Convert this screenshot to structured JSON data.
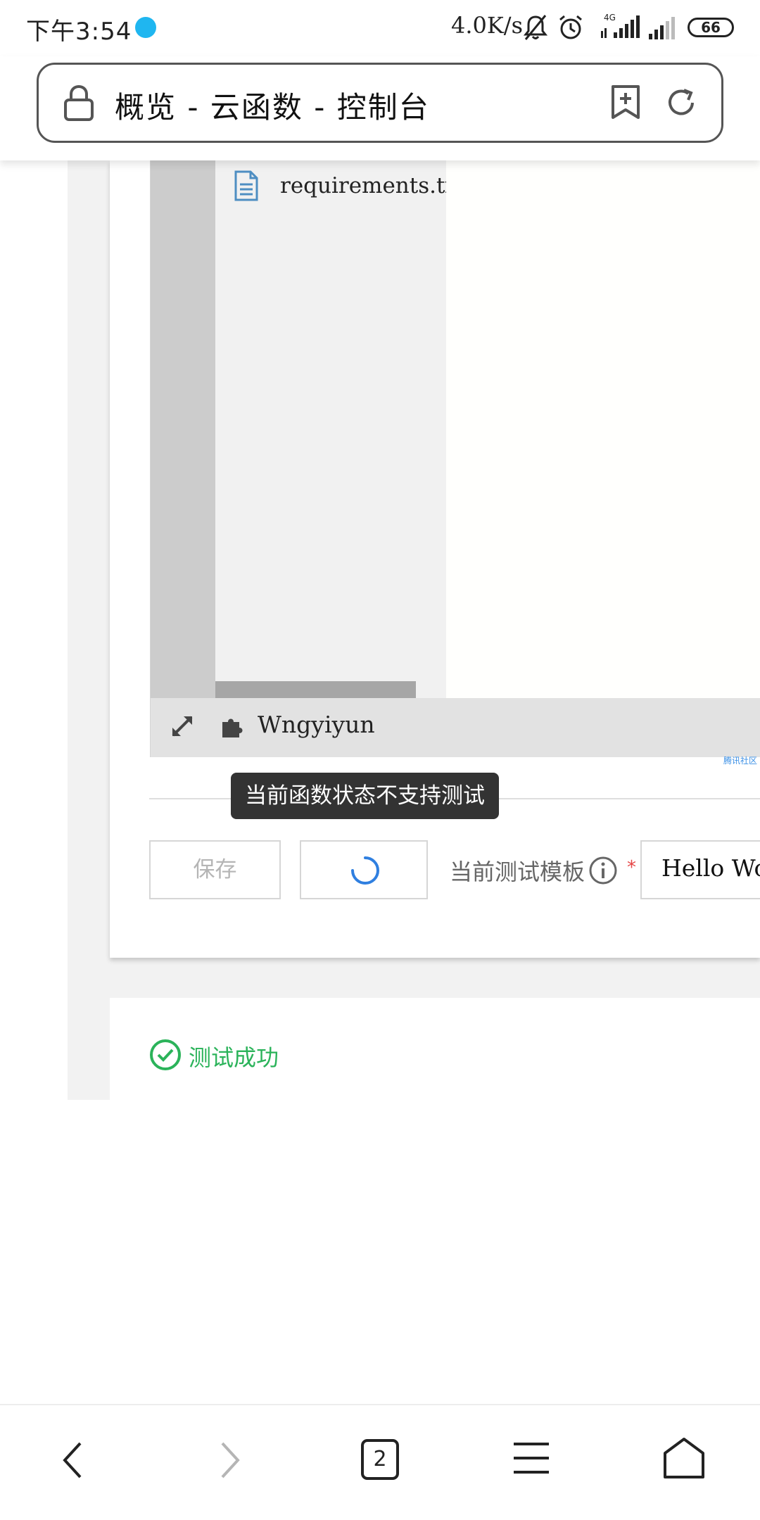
{
  "status_bar": {
    "time": "下午3:54",
    "net_speed": "4.0K/s",
    "network_type": "4G",
    "battery": "66",
    "icons": [
      "app-icon",
      "mute-icon",
      "alarm-icon",
      "signal-icon",
      "signal-icon",
      "battery-icon"
    ]
  },
  "browser": {
    "page_title": "概览 - 云函数 - 控制台",
    "icons": [
      "lock-icon",
      "bookmark-add-icon",
      "reload-icon"
    ]
  },
  "editor": {
    "file_name": "requirements.txt",
    "footer_label": "Wngyiyun",
    "corner_text": "腾讯社区",
    "icons": [
      "file-icon",
      "expand-icon",
      "plugin-icon"
    ]
  },
  "tooltip": {
    "text": "当前函数状态不支持测试"
  },
  "actions": {
    "save_label": "保存",
    "template_label": "当前测试模板",
    "required_mark": "*",
    "template_value": "Hello World"
  },
  "result": {
    "status_text": "测试成功",
    "status_color": "#2bb35a"
  },
  "bottom_nav": {
    "tab_count": "2",
    "icons": [
      "back-icon",
      "forward-icon",
      "tabs-icon",
      "menu-icon",
      "home-icon"
    ]
  },
  "colors": {
    "tooltip_bg": "#333333",
    "required": "#e54545",
    "spinner": "#2f7fe0"
  }
}
